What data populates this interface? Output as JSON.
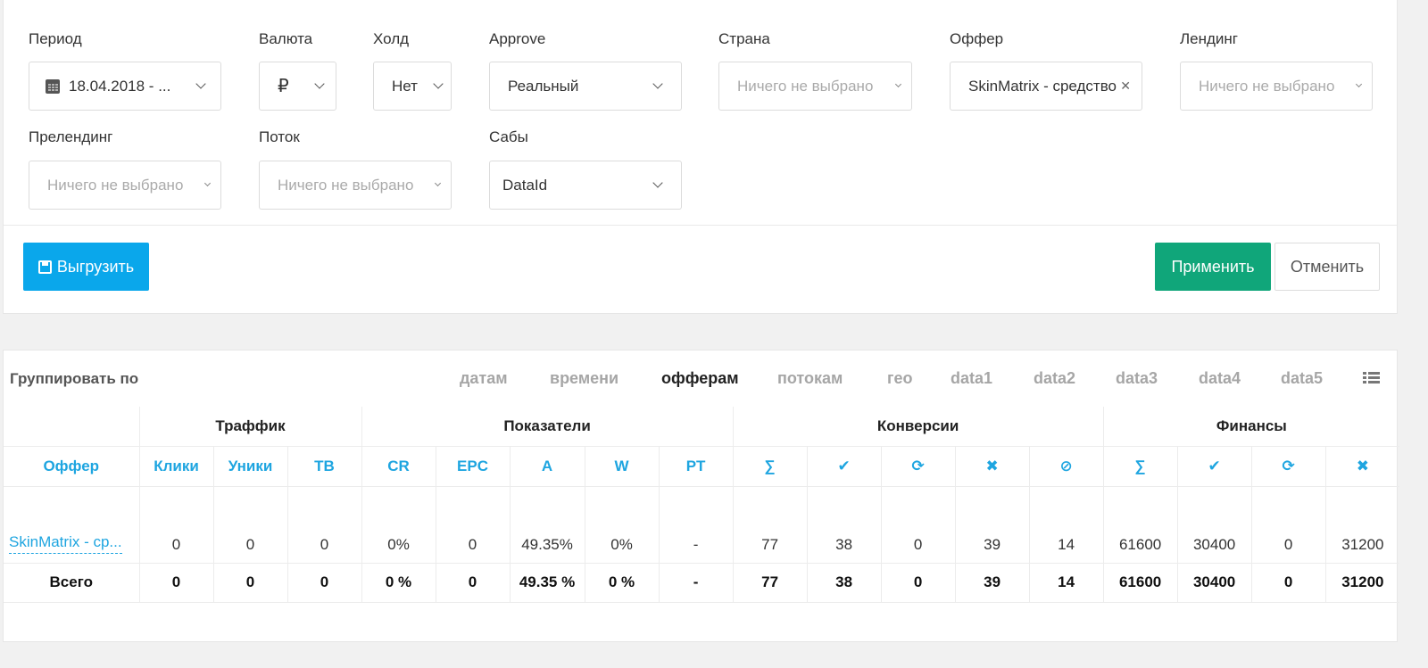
{
  "filters": {
    "period": {
      "label": "Период",
      "value": "18.04.2018 - ..."
    },
    "currency": {
      "label": "Валюта",
      "value": "₽"
    },
    "hold": {
      "label": "Холд",
      "value": "Нет"
    },
    "approve": {
      "label": "Approve",
      "value": "Реальный"
    },
    "country": {
      "label": "Страна",
      "placeholder": "Ничего не выбрано"
    },
    "offer": {
      "label": "Оффер",
      "value": "SkinMatrix - средство"
    },
    "landing": {
      "label": "Лендинг",
      "placeholder": "Ничего не выбрано"
    },
    "prelanding": {
      "label": "Прелендинг",
      "placeholder": "Ничего не выбрано"
    },
    "stream": {
      "label": "Поток",
      "placeholder": "Ничего не выбрано"
    },
    "subs": {
      "label": "Сабы",
      "value": "DataId"
    }
  },
  "buttons": {
    "export": "Выгрузить",
    "apply": "Применить",
    "cancel": "Отменить"
  },
  "colors": {
    "export": "#0aa7eb",
    "apply": "#10a67a",
    "accent": "#1ea5e0"
  },
  "grouping": {
    "label": "Группировать по",
    "tabs": [
      "датам",
      "времени",
      "офферам",
      "потокам",
      "гео",
      "data1",
      "data2",
      "data3",
      "data4",
      "data5"
    ],
    "active": "офферам"
  },
  "table": {
    "groups": [
      "Траффик",
      "Показатели",
      "Конверсии",
      "Финансы"
    ],
    "columns": {
      "offer": "Оффер",
      "clicks": "Клики",
      "uniques": "Уники",
      "tb": "ТВ",
      "cr": "CR",
      "epc": "EPC",
      "a": "A",
      "w": "W",
      "pt": "PT",
      "conv_sum": "∑",
      "fin_sum": "∑"
    },
    "icons": {
      "conv": [
        "sum-icon",
        "check-icon",
        "refresh-icon",
        "cross-icon",
        "ban-icon"
      ],
      "fin": [
        "sum-icon",
        "check-icon",
        "refresh-icon",
        "cross-icon"
      ]
    },
    "row": {
      "offer": "SkinMatrix - ср...",
      "clicks": "0",
      "uniques": "0",
      "tb": "0",
      "cr": "0%",
      "epc": "0",
      "a": "49.35%",
      "w": "0%",
      "pt": "-",
      "conv_total": "77",
      "conv_approved": "38",
      "conv_hold": "0",
      "conv_rejected": "39",
      "conv_trash": "14",
      "fin_total": "61600",
      "fin_approved": "30400",
      "fin_hold": "0",
      "fin_rejected": "31200"
    },
    "total": {
      "label": "Всего",
      "clicks": "0",
      "uniques": "0",
      "tb": "0",
      "cr": "0 %",
      "epc": "0",
      "a": "49.35 %",
      "w": "0 %",
      "pt": "-",
      "conv_total": "77",
      "conv_approved": "38",
      "conv_hold": "0",
      "conv_rejected": "39",
      "conv_trash": "14",
      "fin_total": "61600",
      "fin_approved": "30400",
      "fin_hold": "0",
      "fin_rejected": "31200"
    }
  }
}
